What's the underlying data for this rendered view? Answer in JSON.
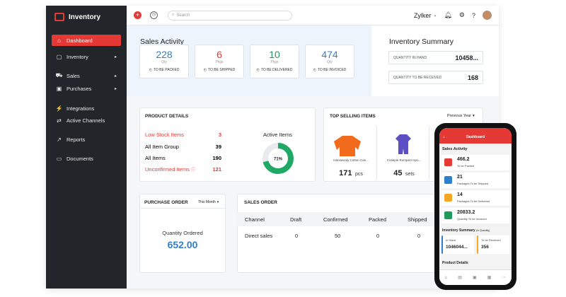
{
  "app": {
    "name": "Inventory",
    "org": "Zylker",
    "search_placeholder": "Search"
  },
  "sidebar": {
    "items": [
      {
        "label": "Dashboard"
      },
      {
        "label": "Inventory"
      },
      {
        "label": "Sales"
      },
      {
        "label": "Purchases"
      },
      {
        "label": "Integrations"
      },
      {
        "label": "Active Channels"
      },
      {
        "label": "Reports"
      },
      {
        "label": "Documents"
      }
    ]
  },
  "sales_activity": {
    "title": "Sales Activity",
    "stats": [
      {
        "value": "228",
        "unit": "Qty",
        "label": "TO BE PACKED",
        "color": "#2f7fd1"
      },
      {
        "value": "6",
        "unit": "Pkgs",
        "label": "TO BE SHIPPED",
        "color": "#e53935"
      },
      {
        "value": "10",
        "unit": "Pkgs",
        "label": "TO BE DELIVERED",
        "color": "#1d9a5c"
      },
      {
        "value": "474",
        "unit": "Qty",
        "label": "TO BE INVOICED",
        "color": "#2f7fd1"
      }
    ]
  },
  "inventory_summary": {
    "title": "Inventory Summary",
    "rows": [
      {
        "label": "QUANTITY IN HAND",
        "value": "10458..."
      },
      {
        "label": "QUANTITY TO BE RECEIVED",
        "value": "168"
      }
    ]
  },
  "product_details": {
    "title": "PRODUCT DETAILS",
    "rows": [
      {
        "label": "Low Stock Items",
        "value": "3"
      },
      {
        "label": "All Item Group",
        "value": "39"
      },
      {
        "label": "All Items",
        "value": "190"
      },
      {
        "label": "Unconfirmed Items",
        "value": "121"
      }
    ],
    "active_items_title": "Active Items",
    "active_pct": 71,
    "active_pct_label": "71%"
  },
  "top_selling": {
    "title": "TOP SELLING ITEMS",
    "period": "Previous Year",
    "items": [
      {
        "name": "Hanswooly Cotton Cas...",
        "qty": "171",
        "unit": "pcs"
      },
      {
        "name": "Cutiepie Rompers-spo...",
        "qty": "45",
        "unit": "sets"
      }
    ]
  },
  "purchase_order": {
    "title": "PURCHASE ORDER",
    "period": "This Month",
    "qty_label": "Quantity Ordered",
    "qty_value": "652.00"
  },
  "sales_order": {
    "title": "SALES ORDER",
    "columns": [
      "Channel",
      "Draft",
      "Confirmed",
      "Packed",
      "Shipped"
    ],
    "rows": [
      [
        "Direct sales",
        "0",
        "50",
        "0",
        "0"
      ]
    ]
  },
  "phone": {
    "header": "Dashboard",
    "sales_activity": "Sales Activity",
    "items": [
      {
        "value": "466.2",
        "label": "To be Packed",
        "color": "#e53935"
      },
      {
        "value": "21",
        "label": "Packages To be Shipped",
        "color": "#2f7fd1"
      },
      {
        "value": "14",
        "label": "Packages To be Delivered",
        "color": "#f5a623"
      },
      {
        "value": "20833.2",
        "label": "Quantity To be Invoiced",
        "color": "#1d9a5c"
      }
    ],
    "inventory_summary": "Inventory Summary",
    "inventory_summary_note": "(In Quantity)",
    "in_hand_label": "In Hand",
    "in_hand_value": "1046044...",
    "to_receive_label": "To be Received",
    "to_receive_value": "356",
    "product_details": "Product Details"
  }
}
